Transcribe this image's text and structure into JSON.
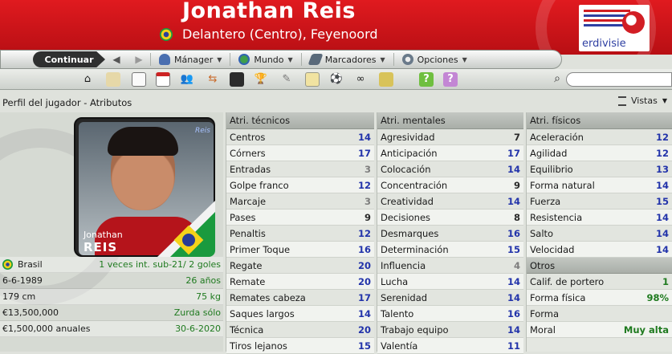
{
  "header": {
    "player_name": "Jonathan Reis",
    "subtitle": "Delantero (Centro), Feyenoord",
    "club_logo_text": "erdivisie"
  },
  "menu": {
    "continue": "Continuar",
    "items": [
      {
        "label": "Mánager",
        "icon": "manager-icon"
      },
      {
        "label": "Mundo",
        "icon": "globe-icon"
      },
      {
        "label": "Marcadores",
        "icon": "scores-icon"
      },
      {
        "label": "Opciones",
        "icon": "options-icon"
      }
    ]
  },
  "panel": {
    "title": "Perfil del jugador - Atributos",
    "views_label": "Vistas"
  },
  "card": {
    "first_name": "Jonathan",
    "last_name": "REIS"
  },
  "info": [
    {
      "left": "Brasil",
      "right": "1 veces int. sub-21/ 2 goles"
    },
    {
      "left": "6-6-1989",
      "right": "26 años"
    },
    {
      "left": "179 cm",
      "right": "75 kg"
    },
    {
      "left": "€13,500,000",
      "right": "Zurda sólo"
    },
    {
      "left": "€1,500,000 anuales",
      "right": "30-6-2020"
    }
  ],
  "technical": {
    "title": "Atri. técnicos",
    "rows": [
      {
        "name": "Centros",
        "value": "14",
        "tone": "blue"
      },
      {
        "name": "Córners",
        "value": "17",
        "tone": "blue"
      },
      {
        "name": "Entradas",
        "value": "3",
        "tone": "grey"
      },
      {
        "name": "Golpe franco",
        "value": "12",
        "tone": "blue"
      },
      {
        "name": "Marcaje",
        "value": "3",
        "tone": "grey"
      },
      {
        "name": "Pases",
        "value": "9",
        "tone": "dark"
      },
      {
        "name": "Penaltis",
        "value": "12",
        "tone": "blue"
      },
      {
        "name": "Primer Toque",
        "value": "16",
        "tone": "blue"
      },
      {
        "name": "Regate",
        "value": "20",
        "tone": "blue"
      },
      {
        "name": "Remate",
        "value": "20",
        "tone": "blue"
      },
      {
        "name": "Remates cabeza",
        "value": "17",
        "tone": "blue"
      },
      {
        "name": "Saques largos",
        "value": "14",
        "tone": "blue"
      },
      {
        "name": "Técnica",
        "value": "20",
        "tone": "blue"
      },
      {
        "name": "Tiros lejanos",
        "value": "15",
        "tone": "blue"
      }
    ]
  },
  "mental": {
    "title": "Atri. mentales",
    "rows": [
      {
        "name": "Agresividad",
        "value": "7",
        "tone": "dark"
      },
      {
        "name": "Anticipación",
        "value": "17",
        "tone": "blue"
      },
      {
        "name": "Colocación",
        "value": "14",
        "tone": "blue"
      },
      {
        "name": "Concentración",
        "value": "9",
        "tone": "dark"
      },
      {
        "name": "Creatividad",
        "value": "14",
        "tone": "blue"
      },
      {
        "name": "Decisiones",
        "value": "8",
        "tone": "dark"
      },
      {
        "name": "Desmarques",
        "value": "16",
        "tone": "blue"
      },
      {
        "name": "Determinación",
        "value": "15",
        "tone": "blue"
      },
      {
        "name": "Influencia",
        "value": "4",
        "tone": "grey"
      },
      {
        "name": "Lucha",
        "value": "14",
        "tone": "blue"
      },
      {
        "name": "Serenidad",
        "value": "14",
        "tone": "blue"
      },
      {
        "name": "Talento",
        "value": "16",
        "tone": "blue"
      },
      {
        "name": "Trabajo equipo",
        "value": "14",
        "tone": "blue"
      },
      {
        "name": "Valentía",
        "value": "11",
        "tone": "blue"
      }
    ]
  },
  "physical": {
    "title": "Atri. físicos",
    "rows": [
      {
        "name": "Aceleración",
        "value": "12",
        "tone": "blue"
      },
      {
        "name": "Agilidad",
        "value": "12",
        "tone": "blue"
      },
      {
        "name": "Equilibrio",
        "value": "13",
        "tone": "blue"
      },
      {
        "name": "Forma natural",
        "value": "14",
        "tone": "blue"
      },
      {
        "name": "Fuerza",
        "value": "15",
        "tone": "blue"
      },
      {
        "name": "Resistencia",
        "value": "14",
        "tone": "blue"
      },
      {
        "name": "Salto",
        "value": "14",
        "tone": "blue"
      },
      {
        "name": "Velocidad",
        "value": "14",
        "tone": "blue"
      }
    ],
    "others_title": "Otros",
    "others": [
      {
        "name": "Calif. de portero",
        "value": "1",
        "tone": "green"
      },
      {
        "name": "Forma física",
        "value": "98%",
        "tone": "green"
      },
      {
        "name": "Forma",
        "value": "",
        "tone": "green"
      },
      {
        "name": "Moral",
        "value": "Muy alta",
        "tone": "green"
      }
    ]
  },
  "colors": {
    "header_red": "#c8141a",
    "value_blue": "#2233aa",
    "value_green": "#1f7a1f"
  }
}
